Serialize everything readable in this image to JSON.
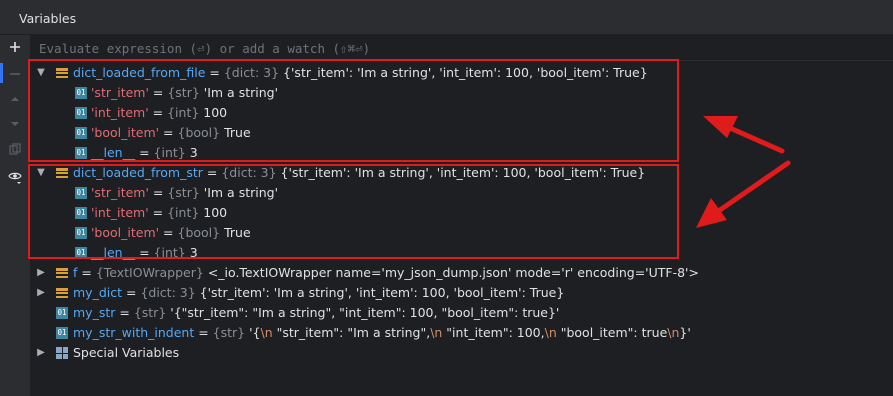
{
  "panel": {
    "title": "Variables"
  },
  "eval": {
    "placeholder": "Evaluate expression (⏎) or add a watch (⇧⌘⏎)"
  },
  "toolbar": {
    "add_icon": "plus-icon",
    "remove_icon": "minus-icon",
    "up_icon": "arrow-up-icon",
    "down_icon": "arrow-down-icon",
    "copy_icon": "copy-icon",
    "watch_icon": "eye-icon"
  },
  "dict_file": {
    "name": "dict_loaded_from_file",
    "eq": " = ",
    "type": "{dict: 3}",
    "value": " {'str_item': 'Im a string', 'int_item': 100, 'bool_item': True}",
    "children": [
      {
        "key": "'str_item'",
        "eq": " = ",
        "type": "{str}",
        "value": " 'Im a string'"
      },
      {
        "key": "'int_item'",
        "eq": " = ",
        "type": "{int}",
        "value": " 100"
      },
      {
        "key": "'bool_item'",
        "eq": " = ",
        "type": "{bool}",
        "value": " True"
      },
      {
        "key": "__len__",
        "eq": " = ",
        "type": "{int}",
        "value": " 3"
      }
    ]
  },
  "dict_str": {
    "name": "dict_loaded_from_str",
    "eq": " = ",
    "type": "{dict: 3}",
    "value": " {'str_item': 'Im a string', 'int_item': 100, 'bool_item': True}",
    "children": [
      {
        "key": "'str_item'",
        "eq": " = ",
        "type": "{str}",
        "value": " 'Im a string'"
      },
      {
        "key": "'int_item'",
        "eq": " = ",
        "type": "{int}",
        "value": " 100"
      },
      {
        "key": "'bool_item'",
        "eq": " = ",
        "type": "{bool}",
        "value": " True"
      },
      {
        "key": "__len__",
        "eq": " = ",
        "type": "{int}",
        "value": " 3"
      }
    ]
  },
  "var_f": {
    "name": "f",
    "eq": " = ",
    "type": "{TextIOWrapper}",
    "value": " <_io.TextIOWrapper name='my_json_dump.json' mode='r' encoding='UTF-8'>"
  },
  "var_my_dict": {
    "name": "my_dict",
    "eq": " = ",
    "type": "{dict: 3}",
    "value": " {'str_item': 'Im a string', 'int_item': 100, 'bool_item': True}"
  },
  "var_my_str": {
    "name": "my_str",
    "eq": " = ",
    "type": "{str}",
    "value": " '{\"str_item\": \"Im a string\", \"int_item\": 100, \"bool_item\": true}'"
  },
  "var_my_str_indent": {
    "name": "my_str_with_indent",
    "eq": " = ",
    "type": "{str}",
    "v1": " '{",
    "e1": "\\n",
    "v2": "  \"str_item\": \"Im a string\",",
    "e2": "\\n",
    "v3": "  \"int_item\": 100,",
    "e3": "\\n",
    "v4": "  \"bool_item\": true",
    "e4": "\\n",
    "v5": "}'"
  },
  "special": {
    "label": "Special Variables"
  },
  "colors": {
    "highlight": "#e01b1b",
    "name": "#56a8f5",
    "key": "#e06c75",
    "type": "#8a8e96",
    "escape": "#cf8e6d"
  }
}
